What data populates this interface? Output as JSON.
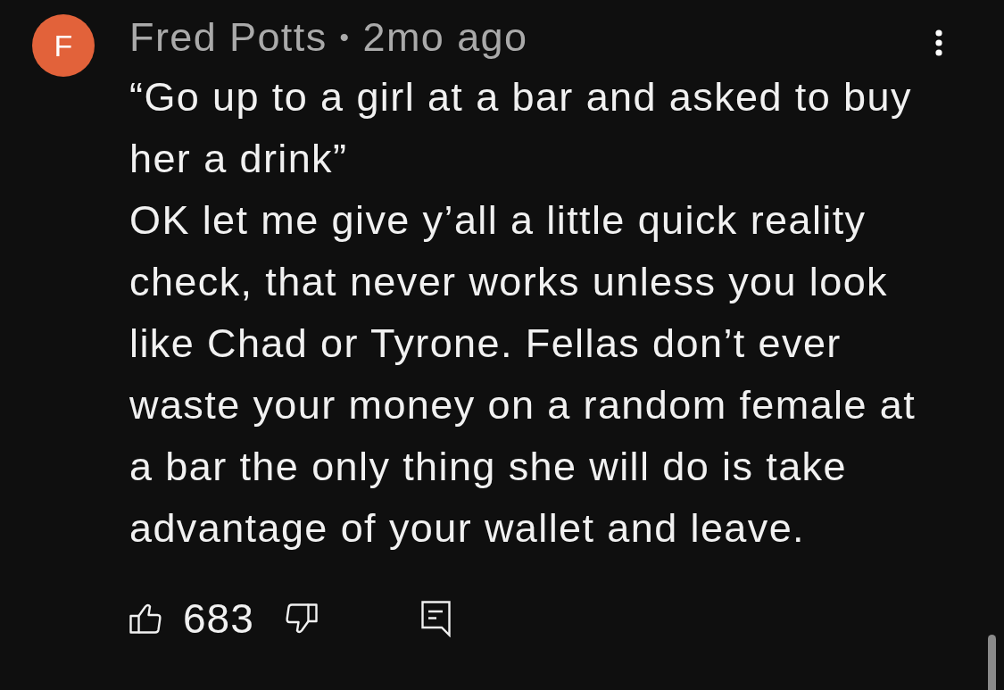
{
  "comment": {
    "avatar": {
      "letter": "F",
      "color": "#e2623a"
    },
    "author": "Fred Potts",
    "separator": "•",
    "time": "2mo ago",
    "paragraphs": [
      "“Go up to a girl at a bar and asked to buy her a drink”",
      "OK let me give y’all a little quick reality check, that never works unless you look like Chad or Tyrone. Fellas don’t ever waste your money on a random female at a bar the only thing she will do is take advantage of your wallet and leave."
    ],
    "likes": "683"
  }
}
